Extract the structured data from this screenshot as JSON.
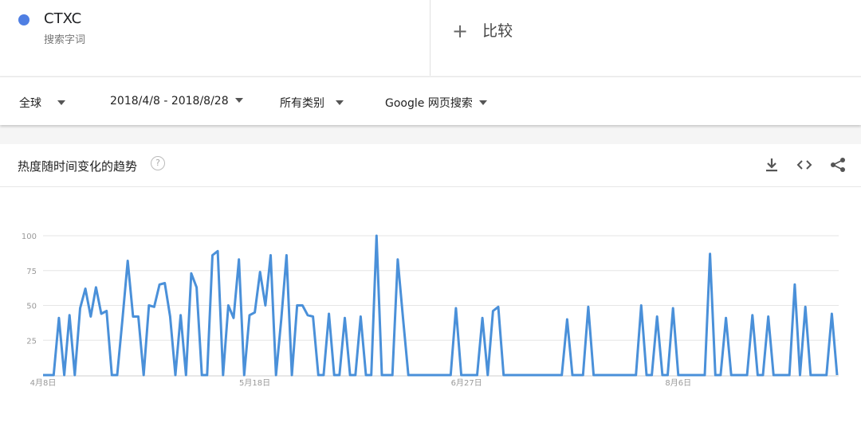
{
  "term": {
    "name": "CTXC",
    "subtitle": "搜索字词",
    "dot_color": "#4f7fe3"
  },
  "compare": {
    "icon": "plus-icon",
    "label": "比较"
  },
  "filters": {
    "region": "全球",
    "date_range": "2018/4/8 - 2018/8/28",
    "category": "所有类别",
    "search_type": "Google 网页搜索"
  },
  "panel": {
    "title": "热度随时间变化的趋势",
    "help_icon": "help-icon",
    "tools": [
      "download-icon",
      "embed-code-icon",
      "share-icon"
    ]
  },
  "chart_data": {
    "type": "line",
    "ylim": [
      0,
      100
    ],
    "y_ticks": [
      "100",
      "75",
      "50",
      "25"
    ],
    "x_ticks": [
      "4月8日",
      "5月18日",
      "6月27日",
      "8月6日"
    ],
    "grid": true,
    "line_color": "#4a90d9",
    "series": [
      {
        "values": [
          0,
          0,
          0,
          41,
          0,
          43,
          0,
          48,
          62,
          42,
          63,
          44,
          46,
          0,
          0,
          40,
          82,
          42,
          42,
          0,
          50,
          49,
          65,
          66,
          42,
          0,
          43,
          0,
          73,
          63,
          0,
          0,
          86,
          89,
          0,
          50,
          41,
          83,
          0,
          43,
          45,
          74,
          50,
          86,
          0,
          40,
          86,
          0,
          50,
          50,
          43,
          42,
          0,
          0,
          44,
          0,
          0,
          41,
          0,
          0,
          42,
          0,
          0,
          100,
          0,
          0,
          0,
          83,
          41,
          0,
          0,
          0,
          0,
          0,
          0,
          0,
          0,
          0,
          48,
          0,
          0,
          0,
          0,
          41,
          0,
          46,
          49,
          0,
          0,
          0,
          0,
          0,
          0,
          0,
          0,
          0,
          0,
          0,
          0,
          40,
          0,
          0,
          0,
          49,
          0,
          0,
          0,
          0,
          0,
          0,
          0,
          0,
          0,
          50,
          0,
          0,
          42,
          0,
          0,
          48,
          0,
          0,
          0,
          0,
          0,
          0,
          87,
          0,
          0,
          41,
          0,
          0,
          0,
          0,
          43,
          0,
          0,
          42,
          0,
          0,
          0,
          0,
          65,
          0,
          49,
          0,
          0,
          0,
          0,
          44,
          0
        ]
      }
    ]
  }
}
